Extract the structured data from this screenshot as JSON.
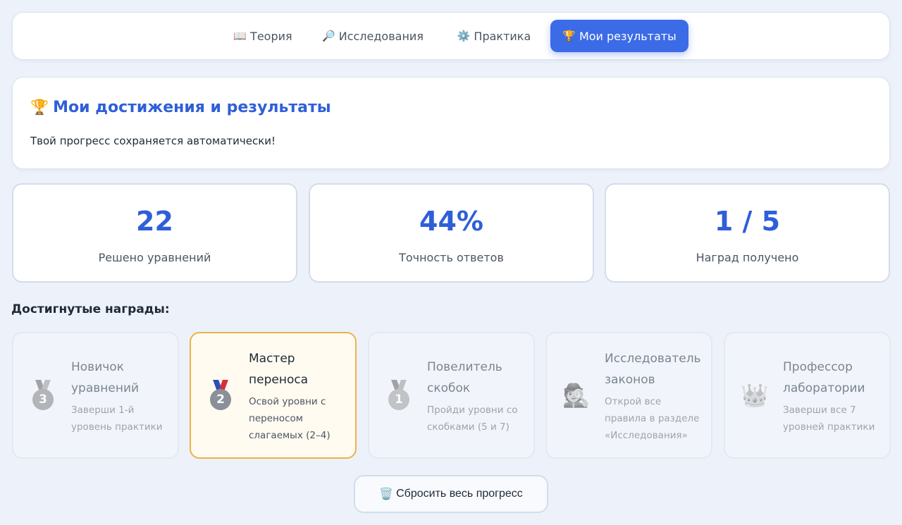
{
  "tabs": [
    {
      "icon": "📖",
      "label": "Теория",
      "active": false
    },
    {
      "icon": "🔎",
      "label": "Исследования",
      "active": false
    },
    {
      "icon": "⚙️",
      "label": "Практика",
      "active": false
    },
    {
      "icon": "🏆",
      "label": "Мои результаты",
      "active": true
    }
  ],
  "header": {
    "icon": "🏆",
    "title": "Мои достижения и результаты",
    "subtitle": "Твой прогресс сохраняется автоматически!"
  },
  "stats": [
    {
      "value": "22",
      "label": "Решено уравнений"
    },
    {
      "value": "44%",
      "label": "Точность ответов"
    },
    {
      "value": "1 / 5",
      "label": "Наград получено"
    }
  ],
  "achievements_heading": "Достигнутые награды:",
  "achievements": [
    {
      "icon": "medal-3-icon",
      "medal_number": "3",
      "name": "Новичок уравнений",
      "description": "Заверши 1-й уровень практики",
      "unlocked": false
    },
    {
      "icon": "medal-2-icon",
      "medal_number": "2",
      "name": "Мастер переноса",
      "description": "Освой уровни с переносом слагаемых (2–4)",
      "unlocked": true
    },
    {
      "icon": "medal-1-icon",
      "medal_number": "1",
      "name": "Повелитель скобок",
      "description": "Пройди уровни со скобками (5 и 7)",
      "unlocked": false
    },
    {
      "icon": "detective-icon",
      "glyph": "🕵️",
      "name": "Исследователь законов",
      "description": "Открой все правила в разделе «Исследования»",
      "unlocked": false
    },
    {
      "icon": "crown-icon",
      "glyph": "👑",
      "name": "Профессор лаборатории",
      "description": "Заверши все 7 уровней практики",
      "unlocked": false
    }
  ],
  "reset": {
    "icon": "🗑️",
    "label": "Сбросить весь прогресс"
  },
  "colors": {
    "accent": "#3b6be6",
    "heading_blue": "#2f5fd8",
    "unlocked_border": "#eab24a",
    "unlocked_bg": "#fffbf0",
    "page_bg": "#edf2fa"
  }
}
